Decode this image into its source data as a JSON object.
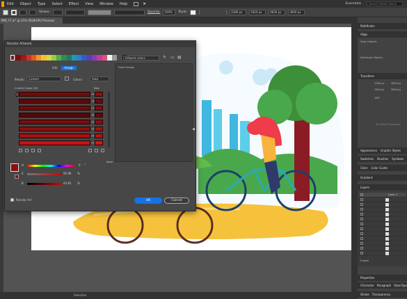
{
  "menubar": {
    "items": [
      "Edit",
      "Object",
      "Type",
      "Select",
      "Effect",
      "View",
      "Window",
      "Help"
    ],
    "workspace": "Essentials",
    "search_placeholder": "Search Adobe Stock"
  },
  "controlbar": {
    "stroke_label": "Stroke:",
    "style_label": "Style:",
    "opacity_label": "Opacity:",
    "opacity_value": "100%",
    "basic_label": "Basic",
    "x_value": "2280 px",
    "y_value": "1600 px",
    "w_value": "4830 px",
    "h_value": "3600 px"
  },
  "document": {
    "tab_title": "MW_57.ai* @ 25% (RGB/GPU Preview)",
    "status_selection": "Selection"
  },
  "dialog": {
    "title": "Recolor Artwork",
    "artwork_colors_placeholder": "Artwork colors",
    "tab_edit": "Edit",
    "tab_assign": "Assign",
    "preset_label": "Preset:",
    "preset_value": "Custom",
    "colors_label": "Colors:",
    "colors_value": "Auto",
    "current_colors_label": "Current Colors (30)",
    "new_label": "New",
    "color_groups_label": "Color Groups",
    "none_label": "None",
    "h_label": "H",
    "s_label": "S",
    "b_label": "B",
    "h_value": "0",
    "s_value": "95.96",
    "b_value": "43.92",
    "percent": "%",
    "degree": "°",
    "recolor_art_label": "Recolor Art",
    "recolor_art_checked": true,
    "ok_label": "OK",
    "cancel_label": "Cancel",
    "strip_colors": [
      "#7a0f0f",
      "#a01818",
      "#c9332a",
      "#e65a1e",
      "#f2932a",
      "#f2c12e",
      "#d9d64a",
      "#9ccc3d",
      "#4caf50",
      "#2e8b57",
      "#1e7a6a",
      "#1a9cb0",
      "#2a7fd4",
      "#3957c8",
      "#5a3fb0",
      "#8a3ab8",
      "#c2409a",
      "#e0507a",
      "#f4f4f4",
      "#9a9a9a",
      "#4a4a4a",
      "#1a1a1a"
    ],
    "row_count": 8
  },
  "dock": {
    "pathfinder": "Pathfinder",
    "align": "Align",
    "align_objects": "Align Objects:",
    "distribute_objects": "Distribute Objects:",
    "transform": "Transform",
    "x_value": "2280 px",
    "y_value": "1600 px",
    "w_value": "4830 px",
    "h_value": "3600 px",
    "angle_value": "180°",
    "no_shape_props": "No Shape Properties",
    "appearance": "Appearance",
    "graphic_styles": "Graphic Styles",
    "swatches": "Swatches",
    "brushes": "Brushes",
    "symbols": "Symbols",
    "color": "Color",
    "color_guide": "Color Guide",
    "gradient": "Gradient",
    "layers": "Layers",
    "layer_name": "Layer 1",
    "layer_count": "1 Layer",
    "properties": "Properties",
    "character": "Character",
    "paragraph": "Paragraph",
    "opentype": "OpenType",
    "stroke": "Stroke",
    "transparency": "Transparency"
  }
}
